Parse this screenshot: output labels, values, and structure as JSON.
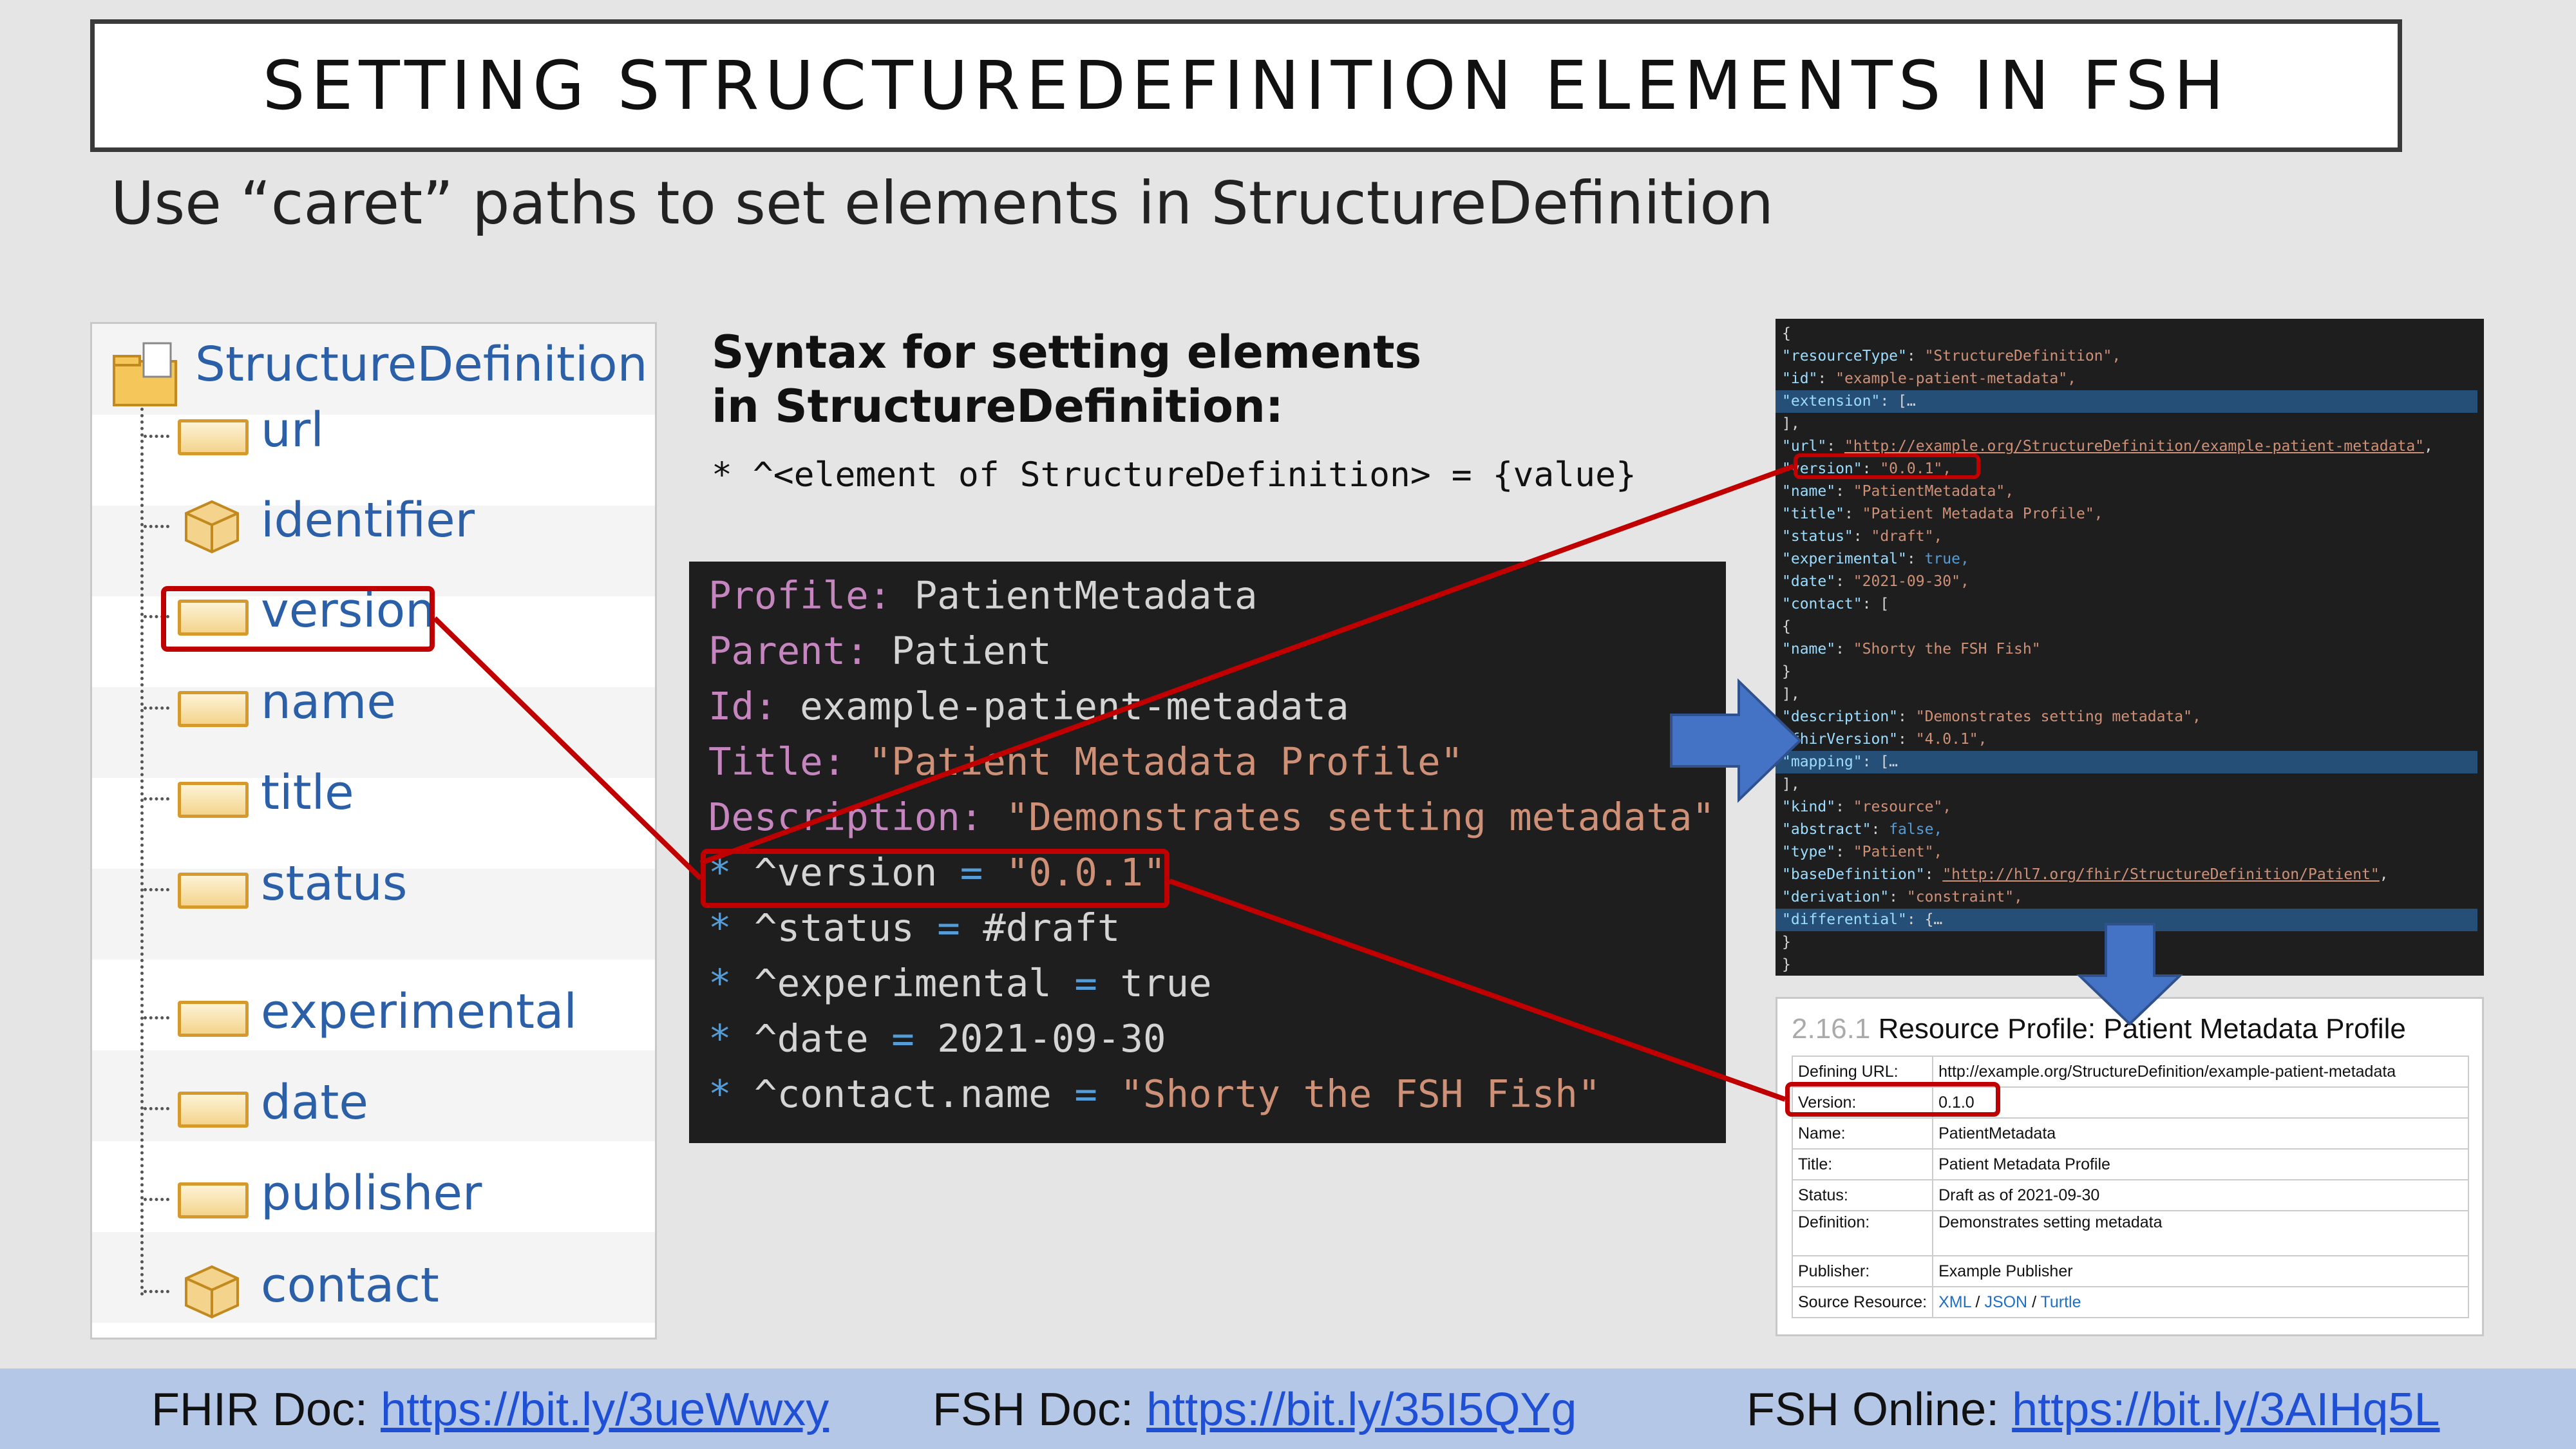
{
  "slide": {
    "title": "SETTING STRUCTUREDEFINITION ELEMENTS IN FSH",
    "subtitle": "Use “caret” paths to set elements in StructureDefinition"
  },
  "tree": {
    "root": "StructureDefinition",
    "items": [
      {
        "label": "url",
        "icon": "element-icon"
      },
      {
        "label": "identifier",
        "icon": "datatype-cube-icon"
      },
      {
        "label": "version",
        "icon": "element-icon"
      },
      {
        "label": "name",
        "icon": "element-icon"
      },
      {
        "label": "title",
        "icon": "element-icon"
      },
      {
        "label": "status",
        "icon": "element-icon"
      },
      {
        "label": "experimental",
        "icon": "element-icon"
      },
      {
        "label": "date",
        "icon": "element-icon"
      },
      {
        "label": "publisher",
        "icon": "element-icon"
      },
      {
        "label": "contact",
        "icon": "datatype-cube-icon"
      }
    ]
  },
  "syntax": {
    "heading": "Syntax for setting elements in StructureDefinition:",
    "line": "* ^<element of StructureDefinition> = {value}"
  },
  "fsh_code": {
    "lines": [
      {
        "k": "Profile:",
        "v": " PatientMetadata"
      },
      {
        "k": "Parent:",
        "v": " Patient"
      },
      {
        "k": "Id:",
        "v": " example-patient-metadata"
      },
      {
        "k": "Title:",
        "v": " \"Patient Metadata Profile\""
      },
      {
        "k": "Description:",
        "v": " \"Demonstrates setting metadata\""
      }
    ],
    "rules": [
      {
        "path": " ^version",
        "eq": " = ",
        "val": "\"0.0.1\""
      },
      {
        "path": " ^status",
        "eq": " = ",
        "val": "#draft"
      },
      {
        "path": " ^experimental",
        "eq": " = ",
        "val": "true"
      },
      {
        "path": " ^date",
        "eq": " = ",
        "val": "2021-09-30"
      },
      {
        "path": " ^contact.name",
        "eq": " = ",
        "val": "\"Shorty the FSH Fish\""
      }
    ]
  },
  "json_view": {
    "lines": [
      "{",
      "  \"resourceType\": \"StructureDefinition\",",
      "  \"id\": \"example-patient-metadata\",",
      "  \"extension\": […",
      "  ],",
      "  \"url\": \"http://example.org/StructureDefinition/example-patient-metadata\",",
      "  \"version\": \"0.0.1\",",
      "  \"name\": \"PatientMetadata\",",
      "  \"title\": \"Patient Metadata Profile\",",
      "  \"status\": \"draft\",",
      "  \"experimental\": true,",
      "  \"date\": \"2021-09-30\",",
      "  \"contact\": [",
      "    {",
      "      \"name\": \"Shorty the FSH Fish\"",
      "    }",
      "  ],",
      "  \"description\": \"Demonstrates setting metadata\",",
      "  \"fhirVersion\": \"4.0.1\",",
      "  \"mapping\": […",
      "  ],",
      "  \"kind\": \"resource\",",
      "  \"abstract\": false,",
      "  \"type\": \"Patient\",",
      "  \"baseDefinition\": \"http://hl7.org/fhir/StructureDefinition/Patient\",",
      "  \"derivation\": \"constraint\",",
      "  \"differential\": {…",
      "  }",
      "}"
    ]
  },
  "profile_page": {
    "section_number": "2.16.1",
    "heading": "Resource Profile: Patient Metadata Profile",
    "rows": [
      {
        "k": "Defining URL:",
        "v": "http://example.org/StructureDefinition/example-patient-metadata"
      },
      {
        "k": "Version:",
        "v": "0.1.0"
      },
      {
        "k": "Name:",
        "v": "PatientMetadata"
      },
      {
        "k": "Title:",
        "v": "Patient Metadata Profile"
      },
      {
        "k": "Status:",
        "v": "Draft as of 2021-09-30"
      },
      {
        "k": "Definition:",
        "v": "Demonstrates setting metadata"
      },
      {
        "k": "Publisher:",
        "v": "Example Publisher"
      }
    ],
    "source_label": "Source Resource:",
    "source_links": [
      "XML",
      "JSON",
      "Turtle"
    ],
    "source_sep": " / "
  },
  "footer": {
    "fhir_label": "FHIR Doc: ",
    "fhir_link": "https://bit.ly/3ueWwxy",
    "fsh_label": "FSH Doc: ",
    "fsh_link": "https://bit.ly/35I5QYg",
    "online_label": "FSH Online: ",
    "online_link": "https://bit.ly/3AIHq5L"
  },
  "colors": {
    "highlight_red": "#c00000",
    "arrow_blue": "#4472c4",
    "footer_bg": "#b4c7e7",
    "tree_label": "#2b5fa7"
  }
}
